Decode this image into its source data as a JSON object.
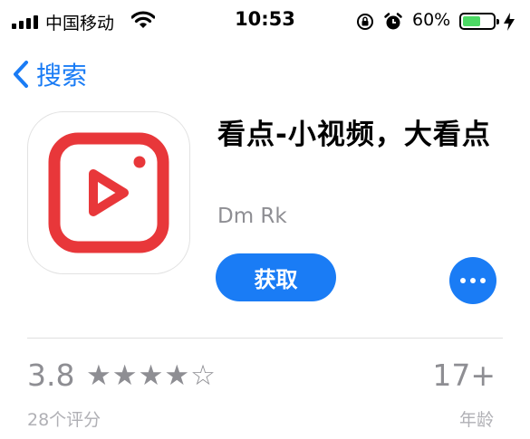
{
  "status_bar": {
    "carrier": "中国移动",
    "time": "10:53",
    "battery_percent": "60%",
    "battery_level": 0.6,
    "icons": [
      "signal-icon",
      "wifi-icon",
      "orientation-lock-icon",
      "alarm-icon",
      "battery-icon",
      "charging-bolt-icon"
    ]
  },
  "nav": {
    "back_label": "搜索",
    "back_icon": "chevron-left-icon"
  },
  "app": {
    "title": "看点-小视频，大看点",
    "developer": "Dm Rk",
    "get_label": "获取",
    "more_icon": "ellipsis-icon",
    "icon_name": "play-app-icon",
    "icon_color": "#e8373a"
  },
  "ratings": {
    "average": "3.8",
    "stars": "★★★★☆",
    "count_label": "28个评分",
    "age_rating": "17+",
    "age_label": "年龄"
  },
  "colors": {
    "accent": "#1a7cf5",
    "secondary_text": "#8e8e93"
  }
}
